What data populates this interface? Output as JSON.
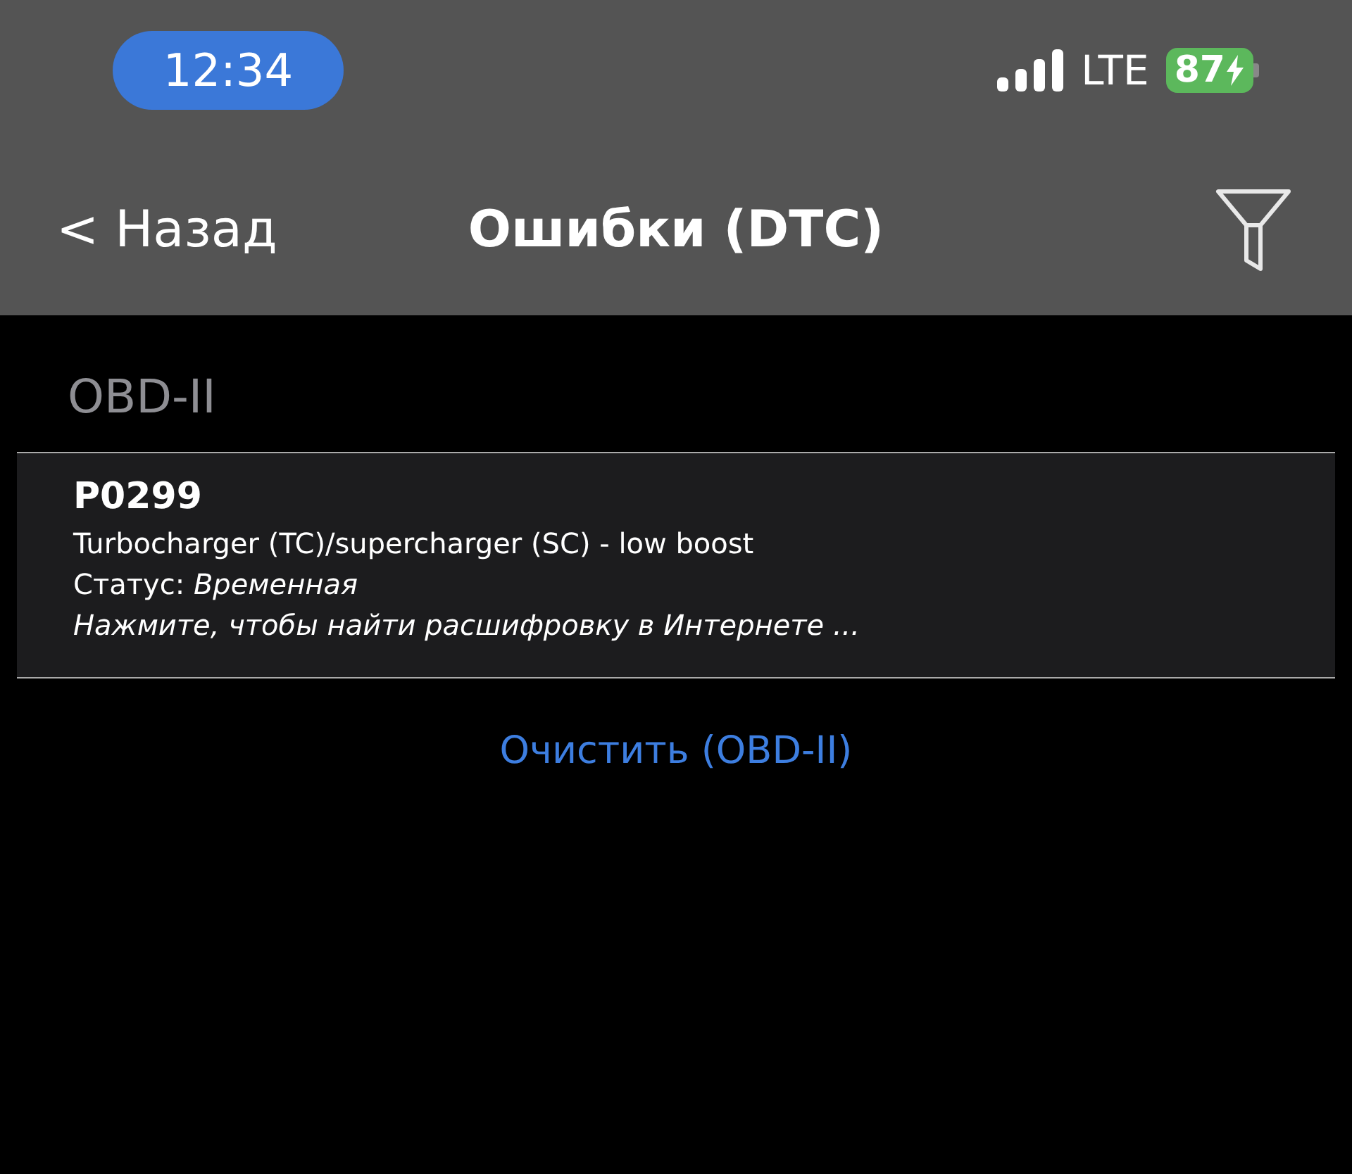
{
  "status_bar": {
    "time": "12:34",
    "network": "LTE",
    "battery": "87",
    "charging": true
  },
  "nav": {
    "back": "< Назад",
    "title": "Ошибки (DTC)"
  },
  "sections": [
    {
      "title": "OBD-II",
      "codes": [
        {
          "code": "P0299",
          "description": "Turbocharger (TC)/supercharger (SC) - low boost",
          "status_label": "Статус:",
          "status": "Временная",
          "hint": "Нажмите, чтобы найти расшифровку в Интернете ..."
        }
      ],
      "clear_button": "Очистить (OBD-II)"
    }
  ]
}
